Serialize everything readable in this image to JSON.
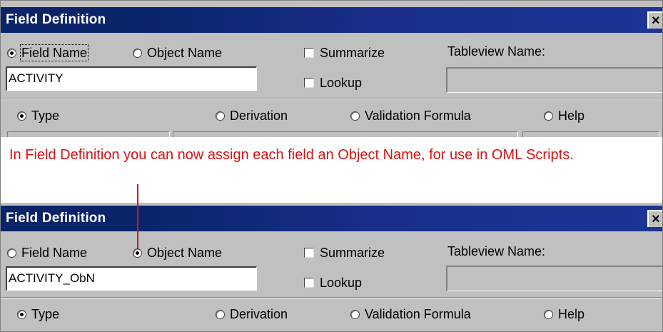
{
  "dialog_top": {
    "title": "Field Definition",
    "close_label": "×",
    "field_name_label": "Field Name",
    "object_name_label": "Object Name",
    "summarize_label": "Summarize",
    "lookup_label": "Lookup",
    "tableview_label": "Tableview Name:",
    "name_value": "ACTIVITY",
    "selected_name_option": "Field Name",
    "tabs": {
      "type": "Type",
      "derivation": "Derivation",
      "validation": "Validation Formula",
      "help": "Help"
    },
    "selected_tab": "Type"
  },
  "annotation": {
    "text": "In Field Definition you can now assign each field an Object Name, for use in OML Scripts.",
    "color": "#e01010"
  },
  "dialog_bottom": {
    "title": "Field Definition",
    "close_label": "×",
    "field_name_label": "Field Name",
    "object_name_label": "Object Name",
    "summarize_label": "Summarize",
    "lookup_label": "Lookup",
    "tableview_label": "Tableview Name:",
    "name_value": "ACTIVITY_ObN",
    "selected_name_option": "Object Name",
    "tabs": {
      "type": "Type",
      "derivation": "Derivation",
      "validation": "Validation Formula",
      "help": "Help"
    },
    "selected_tab": "Type"
  },
  "colors": {
    "titlebar": "#0a246a",
    "dialog_face": "#c0c0c0",
    "annotation_red": "#e01010"
  }
}
